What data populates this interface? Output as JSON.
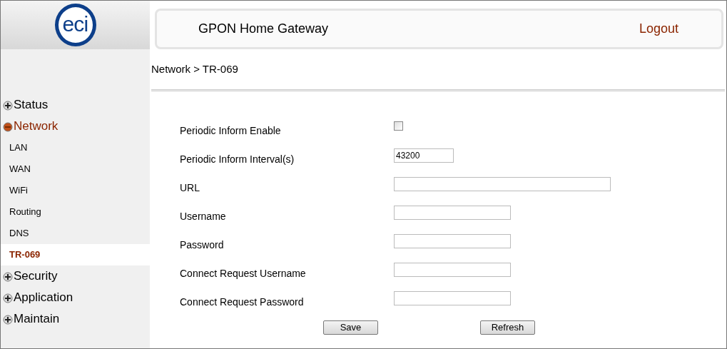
{
  "logo": {
    "text": "eci"
  },
  "header": {
    "title": "GPON Home Gateway",
    "logout": "Logout"
  },
  "breadcrumb": "Network > TR-069",
  "sidebar": {
    "items": [
      {
        "label": "Status",
        "expanded": false
      },
      {
        "label": "Network",
        "expanded": true,
        "children": [
          {
            "label": "LAN",
            "selected": false
          },
          {
            "label": "WAN",
            "selected": false
          },
          {
            "label": "WiFi",
            "selected": false
          },
          {
            "label": "Routing",
            "selected": false
          },
          {
            "label": "DNS",
            "selected": false
          },
          {
            "label": "TR-069",
            "selected": true
          }
        ]
      },
      {
        "label": "Security",
        "expanded": false
      },
      {
        "label": "Application",
        "expanded": false
      },
      {
        "label": "Maintain",
        "expanded": false
      }
    ]
  },
  "form": {
    "fields": [
      {
        "kind": "checkbox",
        "label": "Periodic Inform Enable",
        "checked": false
      },
      {
        "kind": "short",
        "label": "Periodic Inform Interval(s)",
        "value": "43200"
      },
      {
        "kind": "long",
        "label": "URL"
      },
      {
        "kind": "medium",
        "label": "Username"
      },
      {
        "kind": "medium",
        "label": "Password"
      },
      {
        "kind": "medium",
        "label": "Connect Request Username"
      },
      {
        "kind": "medium",
        "label": "Connect Request Password"
      }
    ]
  },
  "buttons": [
    "Save",
    "Refresh"
  ]
}
